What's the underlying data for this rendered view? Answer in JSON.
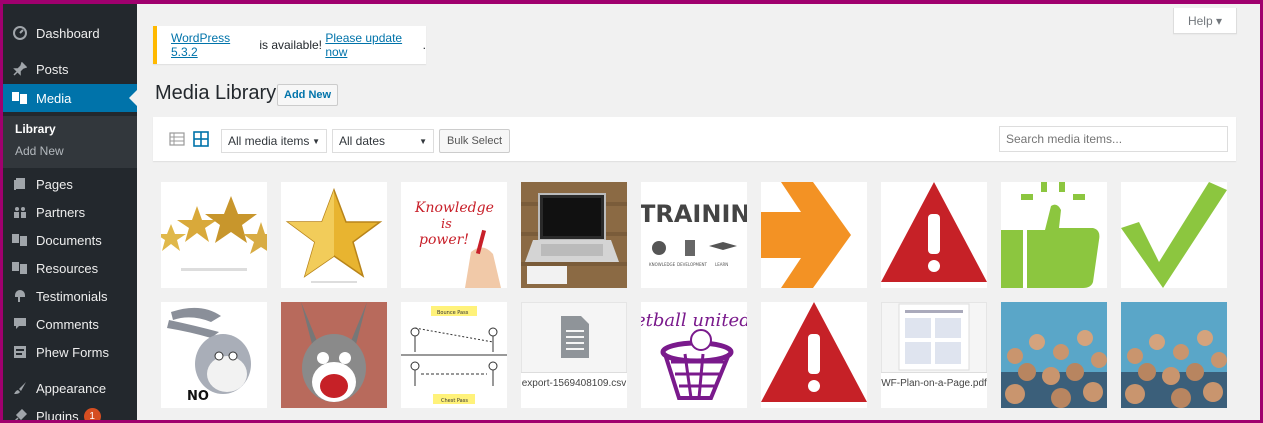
{
  "sidebar": {
    "items": [
      {
        "label": "Dashboard",
        "icon": "dashboard-icon"
      },
      {
        "label": "Posts",
        "icon": "pin-icon"
      },
      {
        "label": "Media",
        "icon": "media-icon"
      },
      {
        "label": "Pages",
        "icon": "pages-icon"
      },
      {
        "label": "Partners",
        "icon": "groups-icon"
      },
      {
        "label": "Documents",
        "icon": "media-icon"
      },
      {
        "label": "Resources",
        "icon": "media-icon"
      },
      {
        "label": "Testimonials",
        "icon": "testimonial-icon"
      },
      {
        "label": "Comments",
        "icon": "comment-icon"
      },
      {
        "label": "Phew Forms",
        "icon": "forms-icon"
      },
      {
        "label": "Appearance",
        "icon": "brush-icon"
      },
      {
        "label": "Plugins",
        "icon": "plugin-icon",
        "badge": "1"
      }
    ],
    "submenu": [
      "Library",
      "Add New"
    ]
  },
  "header": {
    "help_label": "Help ▾"
  },
  "notice": {
    "version_link": "WordPress 5.3.2",
    "middle_text": " is available! ",
    "update_link": "Please update now",
    "end_text": "."
  },
  "page": {
    "title": "Media Library",
    "add_new_label": "Add New"
  },
  "toolbar": {
    "media_filter": "All media items",
    "date_filter": "All dates",
    "bulk_select_label": "Bulk Select",
    "search_placeholder": "Search media items..."
  },
  "media": [
    {
      "kind": "stars",
      "filename": ""
    },
    {
      "kind": "gold-star",
      "filename": ""
    },
    {
      "kind": "knowledge",
      "filename": "",
      "text": [
        "Knowledge",
        "is",
        "power!"
      ]
    },
    {
      "kind": "laptop",
      "filename": ""
    },
    {
      "kind": "training",
      "filename": "",
      "text": [
        "TRAINING",
        "KNOWLEDGE",
        "DEVELOPMENT",
        "LEARN"
      ]
    },
    {
      "kind": "arrow",
      "filename": ""
    },
    {
      "kind": "warning",
      "filename": ""
    },
    {
      "kind": "thumbs-up",
      "filename": ""
    },
    {
      "kind": "checkmark",
      "filename": ""
    },
    {
      "kind": "bugs-no",
      "filename": "",
      "text": [
        "NO"
      ]
    },
    {
      "kind": "bugs-scream",
      "filename": ""
    },
    {
      "kind": "passes",
      "filename": "",
      "text": [
        "Bounce Pass",
        "Chest Pass"
      ]
    },
    {
      "kind": "doc",
      "filename": "export-1569408109.csv"
    },
    {
      "kind": "netball",
      "filename": "",
      "text": [
        "etball united"
      ]
    },
    {
      "kind": "warning",
      "filename": ""
    },
    {
      "kind": "pdf",
      "filename": "WF-Plan-on-a-Page.pdf"
    },
    {
      "kind": "crowd",
      "filename": ""
    },
    {
      "kind": "crowd",
      "filename": ""
    }
  ],
  "colors": {
    "sidebar": "#23282d",
    "active": "#0073aa",
    "warning_red": "#c62127",
    "orange": "#f39224",
    "green": "#8cc63f"
  }
}
